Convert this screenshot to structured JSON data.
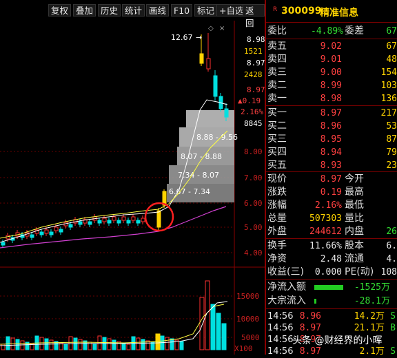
{
  "toolbar": {
    "buttons": [
      "复权",
      "叠加",
      "历史",
      "统计",
      "画线",
      "F10",
      "标记",
      "+自选",
      "返回"
    ]
  },
  "chart": {
    "price_axis": [
      "8.98",
      "8.97",
      "8.97",
      "▲0.19",
      "2.16%",
      "8.00",
      "7.00",
      "6.00",
      "5.00",
      "4.00"
    ],
    "volume_cell_1": "1521",
    "volume_cell_2": "2428",
    "volume_cell_3": "8845",
    "high_label": "12.67",
    "arrow_label": "→",
    "vol_axis": [
      "15000",
      "10000",
      "5000",
      "X100"
    ],
    "chip_labels": [
      "8.88 - 9.56",
      "8.07 - 8.88",
      "7.34 - 8.07",
      "6.67 - 7.34"
    ],
    "colors": {
      "up": "#ff3030",
      "down": "#00e0e0",
      "yellow": "#ffd400",
      "ma_white": "#ffffff",
      "ma_purple": "#d040d0",
      "ma_yellow": "#ffff40"
    }
  },
  "header": {
    "flag": "R",
    "code": "300099",
    "name": "精准信息"
  },
  "weibi": {
    "label": "委比",
    "value": "-4.89%",
    "label2": "委差",
    "value2": "67"
  },
  "sell": [
    {
      "label": "卖五",
      "price": "9.02",
      "vol": "67"
    },
    {
      "label": "卖四",
      "price": "9.01",
      "vol": "48"
    },
    {
      "label": "卖三",
      "price": "9.00",
      "vol": "154"
    },
    {
      "label": "卖二",
      "price": "8.99",
      "vol": "103"
    },
    {
      "label": "卖一",
      "price": "8.98",
      "vol": "136"
    }
  ],
  "buy": [
    {
      "label": "买一",
      "price": "8.97",
      "vol": "217"
    },
    {
      "label": "买二",
      "price": "8.96",
      "vol": "53"
    },
    {
      "label": "买三",
      "price": "8.95",
      "vol": "87"
    },
    {
      "label": "买四",
      "price": "8.94",
      "vol": "79"
    },
    {
      "label": "买五",
      "price": "8.93",
      "vol": "23"
    }
  ],
  "quote": [
    {
      "l1": "现价",
      "v1": "8.97",
      "l2": "今开",
      "v2": ""
    },
    {
      "l1": "涨跌",
      "v1": "0.19",
      "l2": "最高",
      "v2": ""
    },
    {
      "l1": "涨幅",
      "v1": "2.16%",
      "l2": "最低",
      "v2": ""
    },
    {
      "l1": "总量",
      "v1": "507303",
      "l2": "量比",
      "v2": ""
    },
    {
      "l1": "外盘",
      "v1": "244612",
      "l2": "内盘",
      "v2": "26"
    }
  ],
  "stats": [
    {
      "l1": "换手",
      "v1": "11.66%",
      "l2": "股本",
      "v2": "6."
    },
    {
      "l1": "净资",
      "v1": "2.48",
      "l2": "流通",
      "v2": "4."
    },
    {
      "l1": "收益(三)",
      "v1": "0.000",
      "l2": "PE(动)",
      "v2": "108"
    }
  ],
  "flow": [
    {
      "label": "净流入额",
      "value": "-1525万"
    },
    {
      "label": "大宗流入",
      "value": "-28.1万"
    }
  ],
  "ticks": [
    {
      "time": "14:56",
      "price": "8.96",
      "vol": "14.2万",
      "side": "S"
    },
    {
      "time": "14:56",
      "price": "8.97",
      "vol": "21.1万",
      "side": "B"
    },
    {
      "time": "14:56",
      "price": "8.97",
      "vol": "",
      "side": ""
    },
    {
      "time": "14:56",
      "price": "8.97",
      "vol": "2.1万",
      "side": "S"
    }
  ],
  "watermark": "头条 @财经界的小晖"
}
